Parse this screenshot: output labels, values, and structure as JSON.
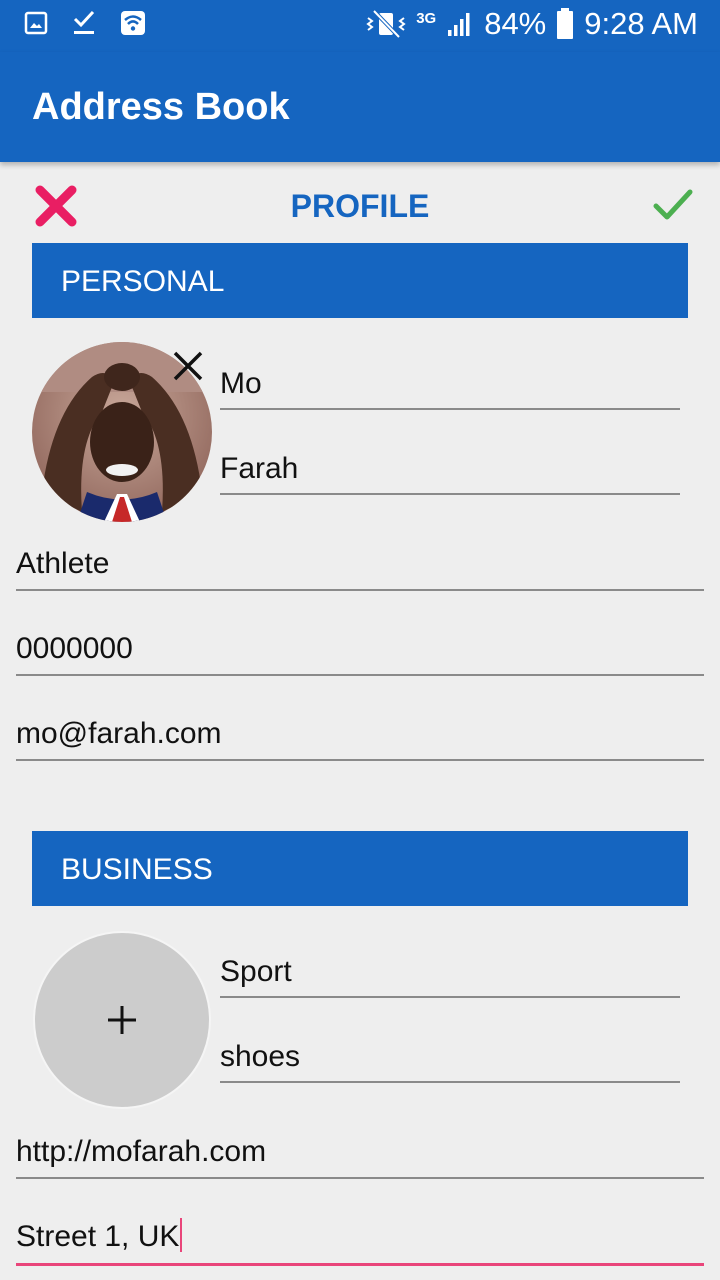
{
  "status_bar": {
    "battery": "84%",
    "time": "9:28 AM",
    "network": "3G",
    "icons": [
      "image-icon",
      "download-done-icon",
      "wifi-icon",
      "vibrate-icon",
      "network-3g-icon",
      "signal-icon",
      "battery-icon"
    ]
  },
  "app_bar": {
    "title": "Address Book"
  },
  "toolbar": {
    "title": "PROFILE",
    "cancel_icon": "close-icon",
    "confirm_icon": "check-icon"
  },
  "personal": {
    "header": "PERSONAL",
    "first_name": "Mo",
    "last_name": "Farah",
    "job_title": "Athlete",
    "phone": "0000000",
    "email": "mo@farah.com"
  },
  "business": {
    "header": "BUSINESS",
    "company": "Sport",
    "department": "shoes",
    "website": "http://mofarah.com",
    "address": "Street 1, UK"
  },
  "colors": {
    "primary": "#1565c0",
    "accent": "#e9457a",
    "cancel": "#e91e63",
    "confirm": "#4caf50",
    "background": "#eeeeee"
  }
}
